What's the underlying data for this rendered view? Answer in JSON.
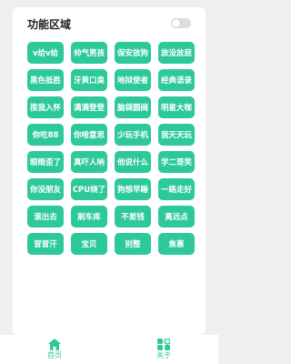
{
  "section": {
    "title": "功能区域"
  },
  "toggle": {
    "on": false
  },
  "buttons": [
    "v给v给",
    "帅气男孩",
    "保安放狗",
    "放没放屁",
    "黑色抵胜",
    "牙黄口臭",
    "地狱使者",
    "经典语录",
    "揽我入怀",
    "满满登登",
    "脑袋圆阀",
    "明星大咖",
    "你吃88",
    "你啥意思",
    "少玩手机",
    "我天天玩",
    "眼睛歪了",
    "真吓人呐",
    "他说什么",
    "学二哥笑",
    "你没朋友",
    "CPU烧了",
    "狗想早睡",
    "一路走好",
    "滚出去",
    "刷车库",
    "不差钱",
    "离远点",
    "冒冒汗",
    "宝贝",
    "别整",
    "焦惠"
  ],
  "nav": {
    "home_label": "首页",
    "about_label": "关于"
  },
  "colors": {
    "accent": "#2dc99a",
    "background": "#eef0ee"
  }
}
